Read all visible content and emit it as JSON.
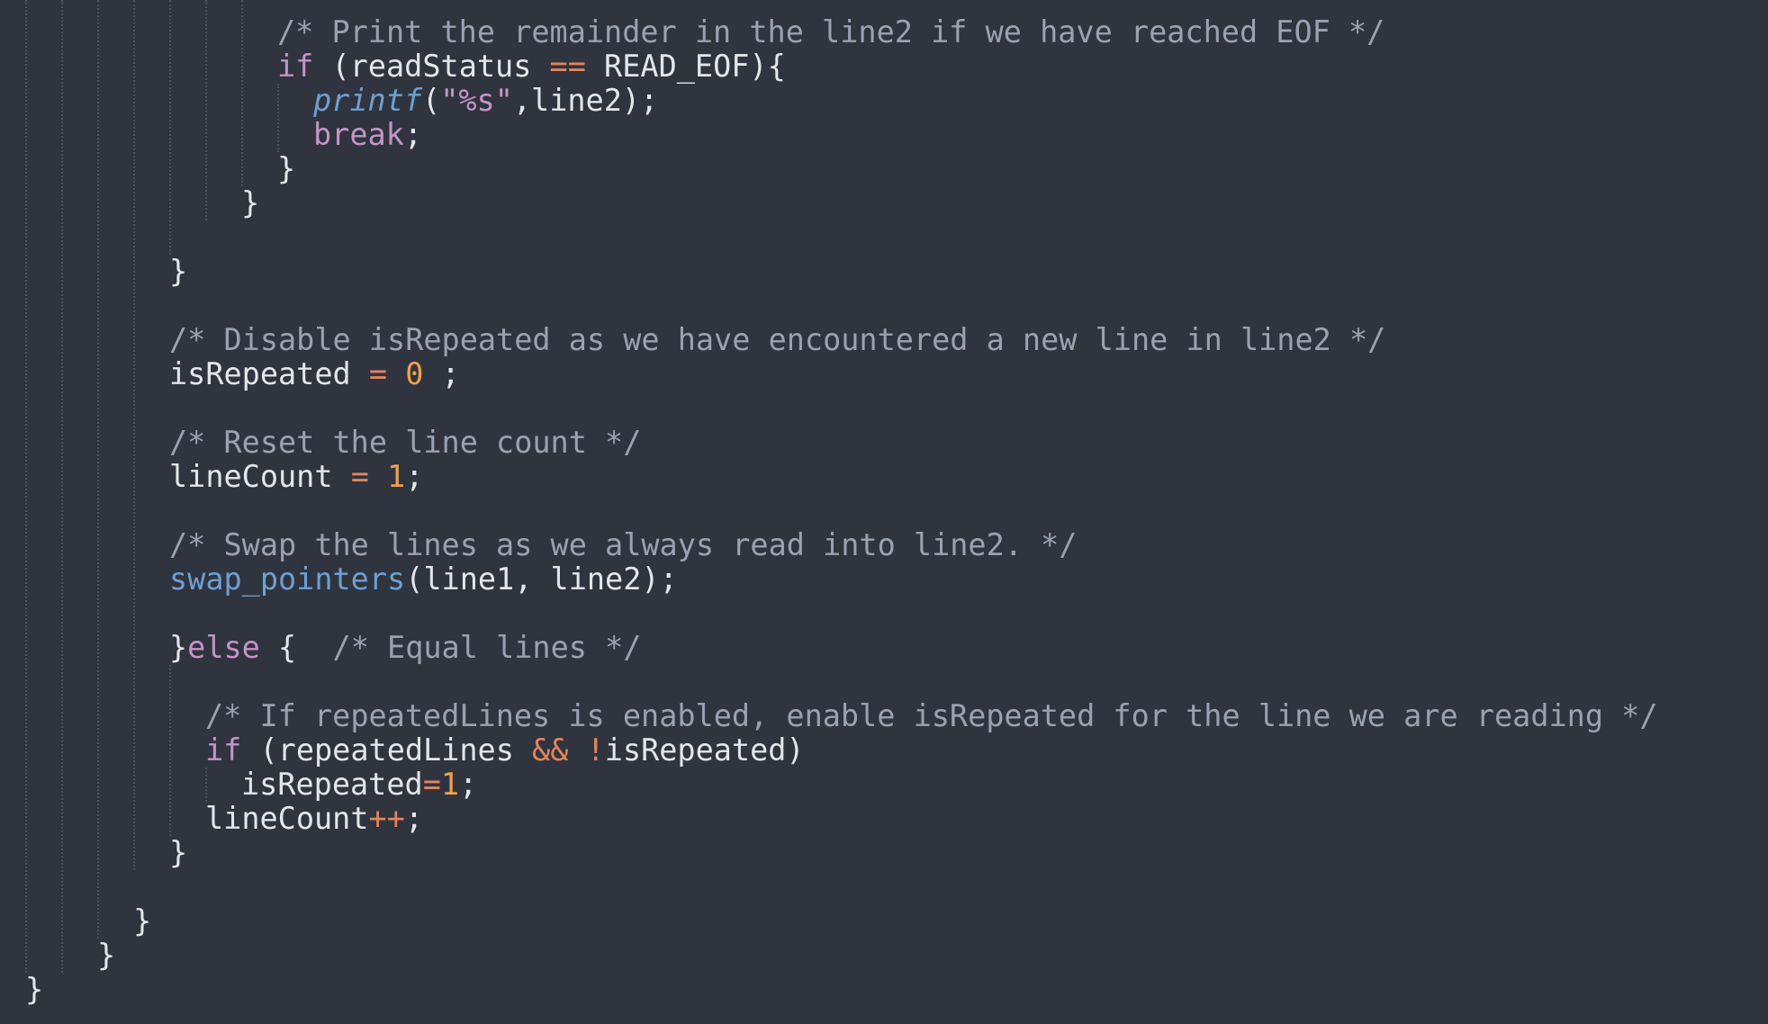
{
  "editor": {
    "language": "c",
    "theme": {
      "background": "#2f343f",
      "comment": "#9aa2b1",
      "keyword": "#c594c5",
      "operator": "#e2845c",
      "number": "#f0a04b",
      "function": "#6f9fd0",
      "plain": "#e4e6ea"
    },
    "lines": [
      {
        "indent": 7,
        "tokens": [
          {
            "t": "comment",
            "v": "/* Print the remainder in the line2 if we have reached EOF */"
          }
        ]
      },
      {
        "indent": 7,
        "tokens": [
          {
            "t": "keyword",
            "v": "if"
          },
          {
            "t": "plain",
            "v": " (readStatus "
          },
          {
            "t": "op",
            "v": "=="
          },
          {
            "t": "plain",
            "v": " READ_EOF){"
          }
        ]
      },
      {
        "indent": 8,
        "tokens": [
          {
            "t": "italic",
            "v": "printf"
          },
          {
            "t": "plain",
            "v": "("
          },
          {
            "t": "string",
            "v": "\"%s\""
          },
          {
            "t": "plain",
            "v": ",line2);"
          }
        ]
      },
      {
        "indent": 8,
        "tokens": [
          {
            "t": "keyword",
            "v": "break"
          },
          {
            "t": "plain",
            "v": ";"
          }
        ]
      },
      {
        "indent": 7,
        "tokens": [
          {
            "t": "plain",
            "v": "}"
          }
        ]
      },
      {
        "indent": 6,
        "tokens": [
          {
            "t": "plain",
            "v": "}"
          }
        ]
      },
      {
        "indent": 5,
        "tokens": []
      },
      {
        "indent": 4,
        "tokens": [
          {
            "t": "plain",
            "v": "}"
          }
        ]
      },
      {
        "indent": 4,
        "tokens": []
      },
      {
        "indent": 4,
        "tokens": [
          {
            "t": "comment",
            "v": "/* Disable isRepeated as we have encountered a new line in line2 */"
          }
        ]
      },
      {
        "indent": 4,
        "tokens": [
          {
            "t": "plain",
            "v": "isRepeated "
          },
          {
            "t": "op",
            "v": "="
          },
          {
            "t": "plain",
            "v": " "
          },
          {
            "t": "number",
            "v": "0"
          },
          {
            "t": "plain",
            "v": " ;"
          }
        ]
      },
      {
        "indent": 4,
        "tokens": []
      },
      {
        "indent": 4,
        "tokens": [
          {
            "t": "comment",
            "v": "/* Reset the line count */"
          }
        ]
      },
      {
        "indent": 4,
        "tokens": [
          {
            "t": "plain",
            "v": "lineCount "
          },
          {
            "t": "op",
            "v": "="
          },
          {
            "t": "plain",
            "v": " "
          },
          {
            "t": "number",
            "v": "1"
          },
          {
            "t": "plain",
            "v": ";"
          }
        ]
      },
      {
        "indent": 4,
        "tokens": []
      },
      {
        "indent": 4,
        "tokens": [
          {
            "t": "comment",
            "v": "/* Swap the lines as we always read into line2. */"
          }
        ]
      },
      {
        "indent": 4,
        "tokens": [
          {
            "t": "func",
            "v": "swap_pointers"
          },
          {
            "t": "plain",
            "v": "(line1, line2);"
          }
        ]
      },
      {
        "indent": 4,
        "tokens": []
      },
      {
        "indent": 4,
        "tokens": [
          {
            "t": "plain",
            "v": "}"
          },
          {
            "t": "keyword",
            "v": "else"
          },
          {
            "t": "plain",
            "v": " {  "
          },
          {
            "t": "comment",
            "v": "/* Equal lines */"
          }
        ]
      },
      {
        "indent": 5,
        "tokens": []
      },
      {
        "indent": 5,
        "tokens": [
          {
            "t": "comment",
            "v": "/* If repeatedLines is enabled, enable isRepeated for the line we are reading */"
          }
        ]
      },
      {
        "indent": 5,
        "tokens": [
          {
            "t": "keyword",
            "v": "if"
          },
          {
            "t": "plain",
            "v": " (repeatedLines "
          },
          {
            "t": "op",
            "v": "&&"
          },
          {
            "t": "plain",
            "v": " "
          },
          {
            "t": "op",
            "v": "!"
          },
          {
            "t": "plain",
            "v": "isRepeated)"
          }
        ]
      },
      {
        "indent": 6,
        "tokens": [
          {
            "t": "plain",
            "v": "isRepeated"
          },
          {
            "t": "op",
            "v": "="
          },
          {
            "t": "number",
            "v": "1"
          },
          {
            "t": "plain",
            "v": ";"
          }
        ]
      },
      {
        "indent": 5,
        "tokens": [
          {
            "t": "plain",
            "v": "lineCount"
          },
          {
            "t": "op",
            "v": "++"
          },
          {
            "t": "plain",
            "v": ";"
          }
        ]
      },
      {
        "indent": 4,
        "tokens": [
          {
            "t": "plain",
            "v": "}"
          }
        ]
      },
      {
        "indent": 3,
        "tokens": []
      },
      {
        "indent": 3,
        "tokens": [
          {
            "t": "plain",
            "v": "}"
          }
        ]
      },
      {
        "indent": 2,
        "tokens": [
          {
            "t": "plain",
            "v": "}"
          }
        ]
      },
      {
        "indent": 0,
        "tokens": [
          {
            "t": "plain",
            "v": "}"
          }
        ]
      }
    ]
  }
}
